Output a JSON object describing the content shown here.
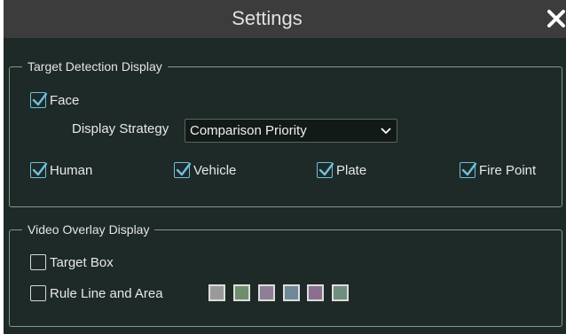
{
  "dialog": {
    "title": "Settings",
    "close_icon": "close-icon"
  },
  "target_detection": {
    "legend": "Target Detection Display",
    "face": {
      "label": "Face",
      "checked": true
    },
    "display_strategy": {
      "label": "Display Strategy",
      "value": "Comparison Priority"
    },
    "human": {
      "label": "Human",
      "checked": true
    },
    "vehicle": {
      "label": "Vehicle",
      "checked": true
    },
    "plate": {
      "label": "Plate",
      "checked": true
    },
    "fire_point": {
      "label": "Fire Point",
      "checked": true
    }
  },
  "video_overlay": {
    "legend": "Video Overlay Display",
    "target_box": {
      "label": "Target Box",
      "checked": false
    },
    "rule_line": {
      "label": "Rule Line and Area",
      "checked": false
    },
    "colors": [
      "#9a9a9a",
      "#6e8f6e",
      "#8e7f97",
      "#6f8797",
      "#8b6f90",
      "#6f8e80"
    ]
  },
  "colors": {
    "accent": "#6fbfdf",
    "background": "#1e2a27",
    "titlebar": "#3c3c3c"
  }
}
